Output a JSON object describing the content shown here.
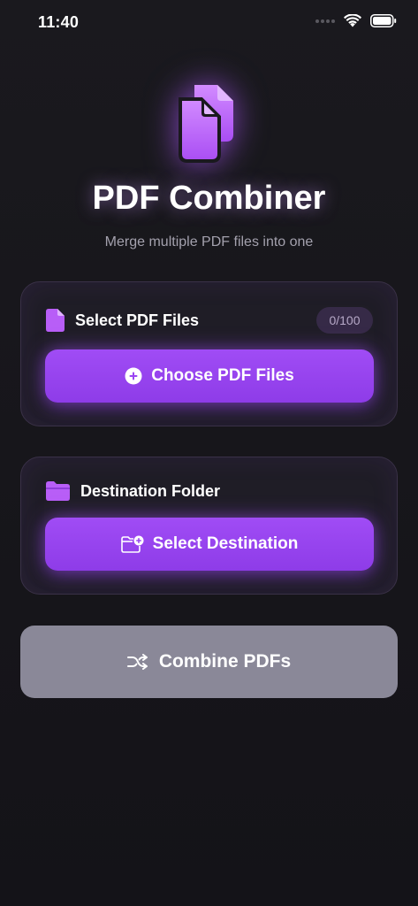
{
  "status_bar": {
    "time": "11:40"
  },
  "header": {
    "title": "PDF Combiner",
    "subtitle": "Merge multiple PDF files into one",
    "icon": "documents-icon"
  },
  "select_card": {
    "label": "Select PDF Files",
    "icon": "document-icon",
    "counter": "0/100",
    "button_label": "Choose PDF Files",
    "button_icon": "plus-circle-icon"
  },
  "destination_card": {
    "label": "Destination Folder",
    "icon": "folder-icon",
    "button_label": "Select Destination",
    "button_icon": "folder-badge-plus-icon"
  },
  "combine_button": {
    "label": "Combine PDFs",
    "icon": "shuffle-icon",
    "enabled": false
  },
  "colors": {
    "accent": "#9B47F2",
    "background": "#17161B",
    "card": "#1F1D26",
    "disabled_button": "#8A8898"
  }
}
